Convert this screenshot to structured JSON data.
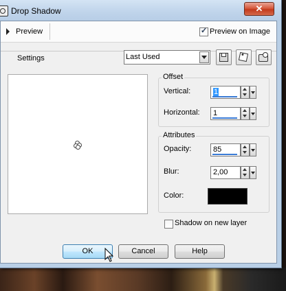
{
  "dialog": {
    "title": "Drop Shadow",
    "close_label": "✕"
  },
  "preview_bar": {
    "preview_label": "Preview",
    "preview_on_image_label": "Preview on Image",
    "preview_on_image_checked": true
  },
  "settings": {
    "label": "Settings",
    "preset_value": "Last Used"
  },
  "offset": {
    "group_title": "Offset",
    "vertical_label": "Vertical:",
    "vertical_value": "1",
    "horizontal_label": "Horizontal:",
    "horizontal_value": "1"
  },
  "attributes": {
    "group_title": "Attributes",
    "opacity_label": "Opacity:",
    "opacity_value": "85",
    "blur_label": "Blur:",
    "blur_value": "2,00",
    "color_label": "Color:",
    "color_value": "#000000"
  },
  "shadow_on_new_layer": {
    "label": "Shadow on new layer",
    "checked": false
  },
  "buttons": {
    "ok": "OK",
    "cancel": "Cancel",
    "help": "Help"
  }
}
